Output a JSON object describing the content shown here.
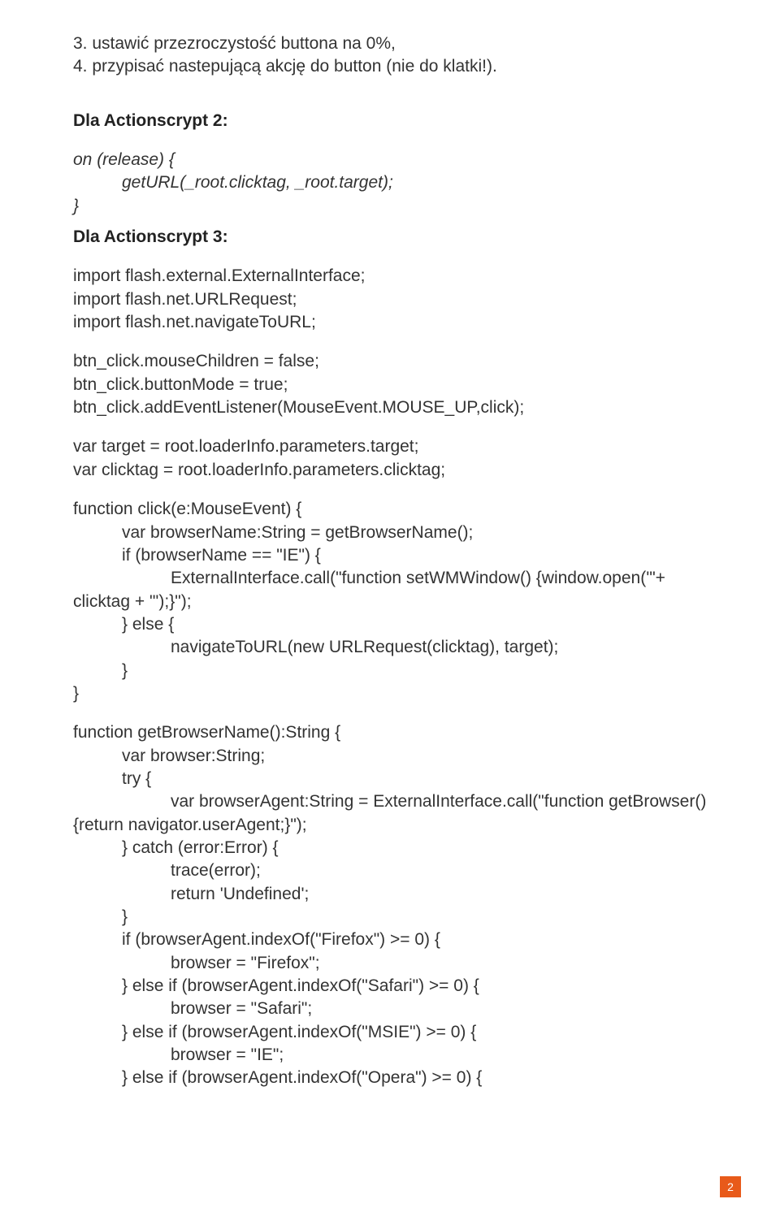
{
  "l1": "3. ustawić przezroczystość buttona na 0%,",
  "l2": "4. przypisać nastepującą akcję do button (nie do klatki!).",
  "h1": "Dla Actionscrypt 2:",
  "c1a": "on (release) {",
  "c1b": "getURL(_root.clicktag, _root.target);",
  "c1c": "}",
  "h2": "Dla Actionscrypt 3:",
  "c2a": "import flash.external.ExternalInterface;",
  "c2b": "import flash.net.URLRequest;",
  "c2c": "import flash.net.navigateToURL;",
  "c3a": "btn_click.mouseChildren = false;",
  "c3b": "btn_click.buttonMode = true;",
  "c3c": "btn_click.addEventListener(MouseEvent.MOUSE_UP,click);",
  "c4a": "var target = root.loaderInfo.parameters.target;",
  "c4b": "var clicktag = root.loaderInfo.parameters.clicktag;",
  "c5a": "function click(e:MouseEvent) {",
  "c5b": "var browserName:String = getBrowserName();",
  "c5c": "if (browserName == \"IE\") {",
  "c5d": "ExternalInterface.call(\"function setWMWindow() {window.open('\"+",
  "c5e": "clicktag + \"');}\");",
  "c5f": "} else {",
  "c5g": "navigateToURL(new URLRequest(clicktag), target);",
  "c5h": "}",
  "c5i": "}",
  "c6a": "function getBrowserName():String {",
  "c6b": "var browser:String;",
  "c6c": "try {",
  "c6d": "var browserAgent:String = ExternalInterface.call(\"function getBrowser()",
  "c6e": "{return navigator.userAgent;}\");",
  "c6f": "} catch (error:Error) {",
  "c6g": "trace(error);",
  "c6h": "return 'Undefined';",
  "c6i": "}",
  "c6j": "if (browserAgent.indexOf(\"Firefox\") >= 0) {",
  "c6k": "browser = \"Firefox\";",
  "c6l": "} else if (browserAgent.indexOf(\"Safari\") >= 0) {",
  "c6m": "browser = \"Safari\";",
  "c6n": "} else if (browserAgent.indexOf(\"MSIE\") >= 0) {",
  "c6o": "browser = \"IE\";",
  "c6p": "} else if (browserAgent.indexOf(\"Opera\") >= 0) {",
  "pageNumber": "2"
}
